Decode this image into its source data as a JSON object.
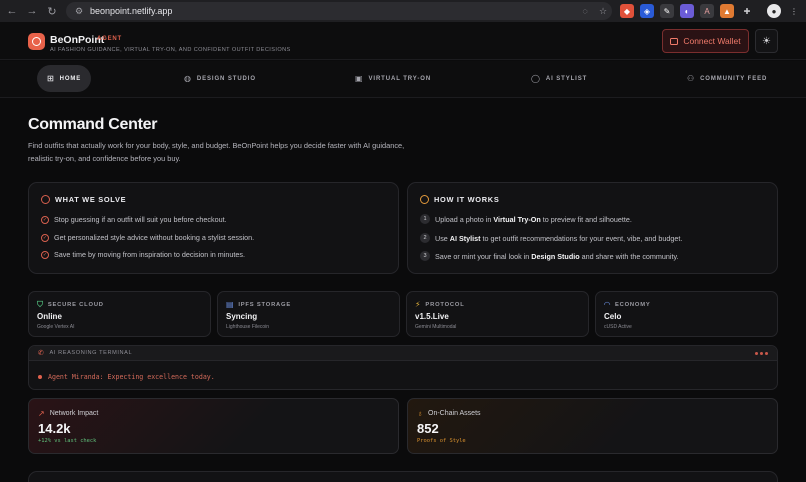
{
  "browser": {
    "url": "beonpoint.netlify.app",
    "nav": {
      "back": "←",
      "forward": "→",
      "reload": "↻"
    },
    "extensions": [
      {
        "icon": "brave-shield-icon",
        "color": "#e0513a"
      },
      {
        "icon": "bitwarden-shield-icon",
        "color": "#2a5bd7"
      },
      {
        "icon": "pen-tool-icon",
        "color": "#3a3a3e"
      },
      {
        "icon": "vpn-icon",
        "color": "#6b5cd6"
      },
      {
        "icon": "a-letter-icon",
        "color": "#3a3a3e"
      },
      {
        "icon": "fox-icon",
        "color": "#e07a32"
      },
      {
        "icon": "puzzle-icon",
        "color": "#3a3a3e"
      }
    ]
  },
  "header": {
    "brand": "BeOnPoint",
    "brand_tag": "AGENT",
    "tagline": "AI FASHION GUIDANCE, VIRTUAL TRY-ON, AND CONFIDENT OUTFIT DECISIONS",
    "connect_label": "Connect Wallet",
    "theme_icon": "sun-icon",
    "accent_color": "#e0614d"
  },
  "nav": {
    "items": [
      {
        "label": "HOME",
        "icon": "grid-icon",
        "active": true
      },
      {
        "label": "DESIGN STUDIO",
        "icon": "palette-icon"
      },
      {
        "label": "VIRTUAL TRY-ON",
        "icon": "camera-icon"
      },
      {
        "label": "AI STYLIST",
        "icon": "chat-bubble-icon"
      },
      {
        "label": "COMMUNITY FEED",
        "icon": "users-icon"
      }
    ]
  },
  "main": {
    "title": "Command Center",
    "intro": "Find outfits that actually work for your body, style, and budget. BeOnPoint helps you decide faster with AI guidance, realistic try-on, and confidence before you buy."
  },
  "solve": {
    "heading": "WHAT WE SOLVE",
    "items": [
      "Stop guessing if an outfit will suit you before checkout.",
      "Get personalized style advice without booking a stylist session.",
      "Save time by moving from inspiration to decision in minutes."
    ]
  },
  "how": {
    "heading": "HOW IT WORKS",
    "steps": [
      {
        "num": "1",
        "pre": "Upload a photo in ",
        "bold": "Virtual Try-On",
        "post": " to preview fit and silhouette."
      },
      {
        "num": "2",
        "pre": "Use ",
        "bold": "AI Stylist",
        "post": " to get outfit recommendations for your event, vibe, and budget."
      },
      {
        "num": "3",
        "pre": "Save or mint your final look in ",
        "bold": "Design Studio",
        "post": " and share with the community."
      }
    ]
  },
  "stats": [
    {
      "label": "SECURE CLOUD",
      "value": "Online",
      "sub": "Google Vertex AI",
      "icon": "shield-check-icon",
      "color": "#4caf74"
    },
    {
      "label": "IPFS STORAGE",
      "value": "Syncing",
      "sub": "Lighthouse Filecoin",
      "icon": "database-icon",
      "color": "#6b8fe0"
    },
    {
      "label": "PROTOCOL",
      "value": "v1.5.Live",
      "sub": "Gemini Multimodal",
      "icon": "lightning-icon",
      "color": "#e3b23c"
    },
    {
      "label": "ECONOMY",
      "value": "Celo",
      "sub": "cUSD Active",
      "icon": "wifi-icon",
      "color": "#6b8fe0"
    }
  ],
  "terminal": {
    "title": "AI REASONING TERMINAL",
    "line": "Agent Miranda: Expecting excellence today."
  },
  "metrics": [
    {
      "label": "Network Impact",
      "value": "14.2k",
      "sub": "+12% vs last check",
      "icon": "trend-up-icon",
      "sub_color": "#5fbf7a"
    },
    {
      "label": "On-Chain Assets",
      "value": "852",
      "sub": "Proofs of Style",
      "icon": "medal-icon",
      "sub_color": "#d9912f"
    }
  ]
}
